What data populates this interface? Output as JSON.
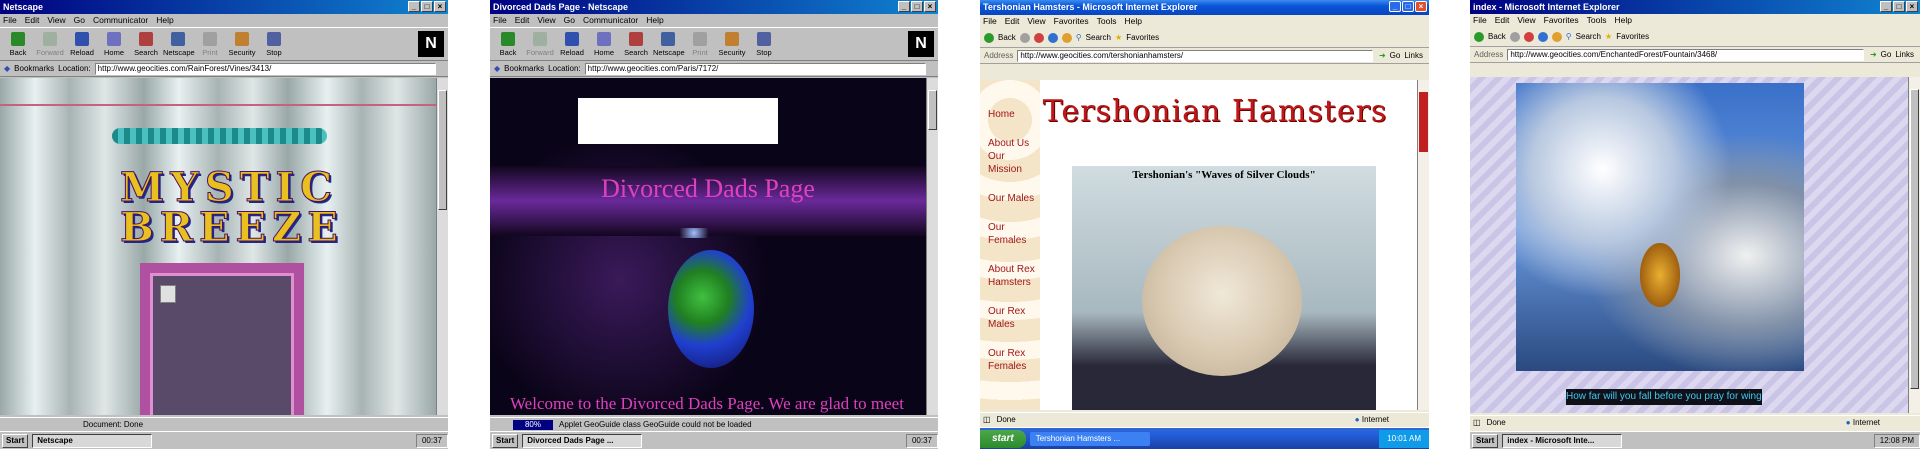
{
  "p1": {
    "title": "Netscape",
    "menu": [
      "File",
      "Edit",
      "View",
      "Go",
      "Communicator",
      "Help"
    ],
    "toolbar": [
      "Back",
      "Forward",
      "Reload",
      "Home",
      "Search",
      "Netscape",
      "Print",
      "Security",
      "Stop"
    ],
    "bookmarks": "Bookmarks",
    "location_label": "Location:",
    "url": "http://www.geocities.com/RainForest/Vines/3413/",
    "logo_line1": "MYSTIC",
    "logo_line2": "BREEZE",
    "status": "Document: Done",
    "start": "Start",
    "task": "Netscape",
    "clock": "00:37"
  },
  "p2": {
    "title": "Divorced Dads Page - Netscape",
    "menu": [
      "File",
      "Edit",
      "View",
      "Go",
      "Communicator",
      "Help"
    ],
    "toolbar": [
      "Back",
      "Forward",
      "Reload",
      "Home",
      "Search",
      "Netscape",
      "Print",
      "Security",
      "Stop"
    ],
    "bookmarks": "Bookmarks",
    "location_label": "Location:",
    "url": "http://www.geocities.com/Paris/7172/",
    "heading": "Divorced Dads Page",
    "welcome": "Welcome to the Divorced Dads Page. We are glad to meet",
    "progress": "80%",
    "status": "Applet GeoGuide class GeoGuide could not be loaded",
    "start": "Start",
    "task": "Divorced Dads Page ...",
    "clock": "00:37"
  },
  "p3": {
    "title": "Tershonian Hamsters - Microsoft Internet Explorer",
    "menu": [
      "File",
      "Edit",
      "View",
      "Favorites",
      "Tools",
      "Help"
    ],
    "back": "Back",
    "search": "Search",
    "favorites": "Favorites",
    "address_label": "Address",
    "url": "http://www.geocities.com/tershonianhamsters/",
    "go": "Go",
    "links": "Links",
    "nav": [
      "Home",
      "About Us Our Mission",
      "Our Males",
      "Our Females",
      "About Rex Hamsters",
      "Our Rex Males",
      "Our Rex Females"
    ],
    "banner": "Tershonian Hamsters",
    "caption": "Tershonian's \"Waves of Silver Clouds\"",
    "status": "Done",
    "zone": "Internet",
    "start": "start",
    "task": "Tershonian Hamsters ...",
    "clock": "10:01 AM"
  },
  "p4": {
    "title": "index - Microsoft Internet Explorer",
    "menu": [
      "File",
      "Edit",
      "View",
      "Favorites",
      "Tools",
      "Help"
    ],
    "back": "Back",
    "search": "Search",
    "favorites": "Favorites",
    "address_label": "Address",
    "url": "http://www.geocities.com/EnchantedForest/Fountain/3468/",
    "go": "Go",
    "links": "Links",
    "caption": "How far will you fall before you pray for wings.",
    "status": "Done",
    "zone": "Internet",
    "start": "Start",
    "task": "index - Microsoft Inte...",
    "clock": "12:08 PM"
  }
}
